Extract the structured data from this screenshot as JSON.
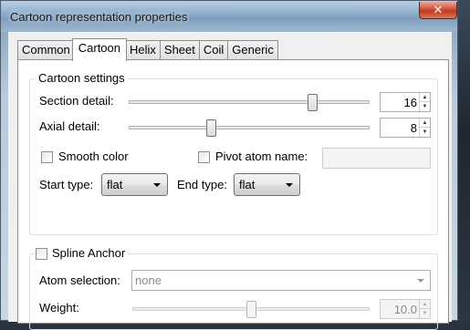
{
  "window": {
    "title": "Cartoon representation properties",
    "close_glyph": "✕"
  },
  "tabs": [
    {
      "label": "Common",
      "active": false
    },
    {
      "label": "Cartoon",
      "active": true
    },
    {
      "label": "Helix",
      "active": false
    },
    {
      "label": "Sheet",
      "active": false
    },
    {
      "label": "Coil",
      "active": false
    },
    {
      "label": "Generic",
      "active": false
    }
  ],
  "cartoon_settings": {
    "title": "Cartoon settings",
    "section_detail": {
      "label": "Section detail:",
      "value": "16",
      "slider_fraction": 0.76
    },
    "axial_detail": {
      "label": "Axial detail:",
      "value": "8",
      "slider_fraction": 0.34
    },
    "smooth_color": {
      "label": "Smooth color",
      "checked": false
    },
    "pivot_atom": {
      "label": "Pivot atom name:",
      "checked": false,
      "value": ""
    },
    "start_type": {
      "label": "Start type:",
      "value": "flat"
    },
    "end_type": {
      "label": "End type:",
      "value": "flat"
    }
  },
  "spline_anchor": {
    "title": "Spline Anchor",
    "checked": false,
    "atom_selection": {
      "label": "Atom selection:",
      "value": "none"
    },
    "weight": {
      "label": "Weight:",
      "value": "10.0",
      "slider_fraction": 0.5
    }
  },
  "icons": {
    "spin_up": "▲",
    "spin_down": "▼"
  }
}
